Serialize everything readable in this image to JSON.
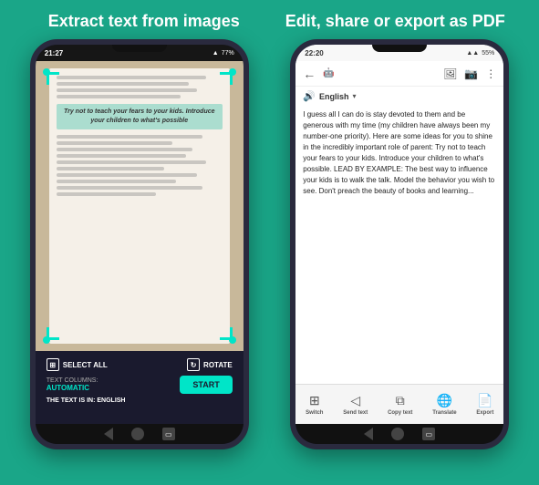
{
  "app": {
    "bg_color": "#1aa688"
  },
  "left_panel": {
    "title": "Extract text from\nimages",
    "statusbar": {
      "time": "21:27",
      "battery": "77%"
    },
    "book_highlight_text": "Try not to teach your fears\nto your kids. Introduce your children\nto what's possible",
    "controls": {
      "select_all": "SELECT ALL",
      "rotate": "ROTATE",
      "text_columns_label": "TEXT COLUMNS:",
      "text_columns_value": "AUTOMATIC",
      "start_label": "START",
      "language_label": "THE TEXT IS IN:",
      "language_value": "ENGLISH"
    }
  },
  "right_panel": {
    "title": "Edit, share or\nexport as PDF",
    "statusbar": {
      "time": "22:20",
      "battery": "55%"
    },
    "toolbar": {
      "back": "←",
      "app_icon": "🤖",
      "image_icon": "🖼",
      "camera_icon": "📷",
      "more_icon": "⋮"
    },
    "language": {
      "icon": "🔊",
      "label": "English",
      "dropdown": "▾"
    },
    "text_content": "I guess all I can do is stay devoted to them and be generous with my time (my children have always been my number-one priority). Here are some ideas for you to shine in the incredibly\n\nimportant role of parent:\n\nTry not to teach your fears to your kids. Introduce your children\n\nto what's possible.\n\nLEAD BY EXAMPLE: The best way to influence your kids is to walk the talk. Model the behavior you wish to see. Don't preach the beauty of books and learning...",
    "bottom_actions": [
      {
        "icon": "⊞",
        "label": "Switch"
      },
      {
        "icon": "◁",
        "label": "Send text"
      },
      {
        "icon": "⧉",
        "label": "Copy text"
      },
      {
        "icon": "🌐",
        "label": "Translate"
      },
      {
        "icon": "📄",
        "label": "Export"
      }
    ]
  }
}
